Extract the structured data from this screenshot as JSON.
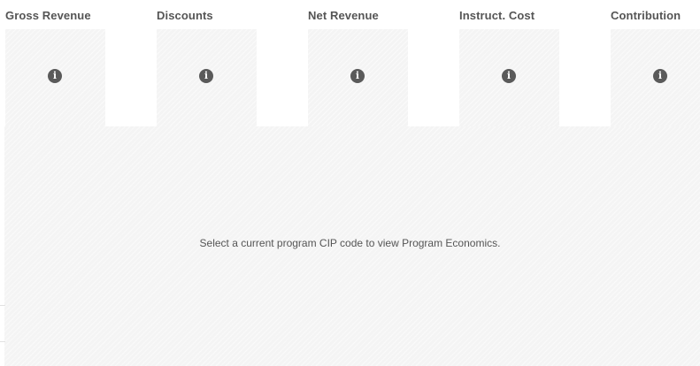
{
  "kpis": [
    {
      "title": "Gross Revenue",
      "icon": "info-icon"
    },
    {
      "title": "Discounts",
      "icon": "info-icon"
    },
    {
      "title": "Net Revenue",
      "icon": "info-icon"
    },
    {
      "title": "Instruct. Cost",
      "icon": "info-icon"
    },
    {
      "title": "Contribution",
      "icon": "info-icon"
    }
  ],
  "info_glyph": "i",
  "message": "Select a current program CIP code to view Program Economics."
}
